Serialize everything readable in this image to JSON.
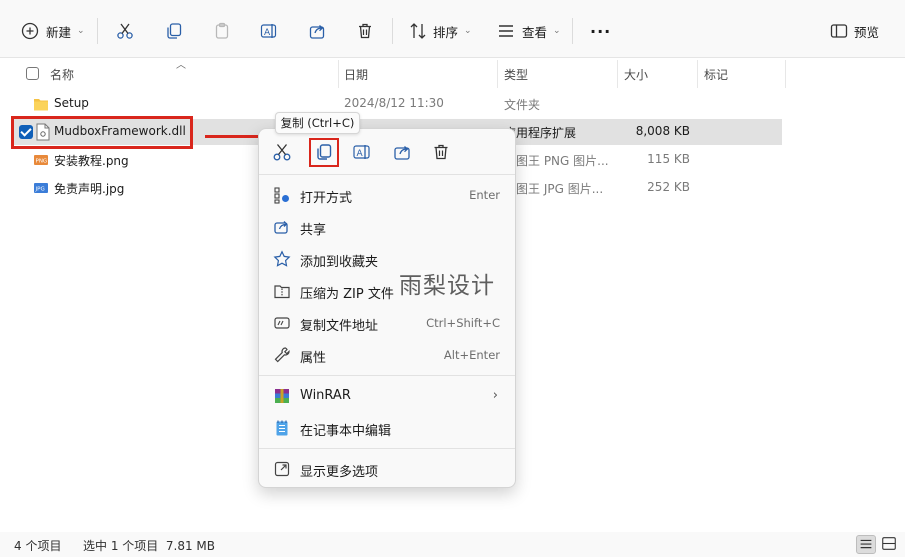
{
  "toolbar": {
    "new_label": "新建",
    "sort_label": "排序",
    "view_label": "查看",
    "more_label": "···",
    "preview_label": "预览"
  },
  "columns": {
    "name": "名称",
    "date": "日期",
    "type": "类型",
    "size": "大小",
    "tags": "标记"
  },
  "files": [
    {
      "name": "Setup",
      "date": "2024/8/12 11:30",
      "type": "文件夹",
      "size": "",
      "icon": "folder-icon"
    },
    {
      "name": "MudboxFramework.dll",
      "date": "",
      "type": "应用程序扩展",
      "size": "8,008 KB",
      "icon": "dll-file-icon",
      "selected": true
    },
    {
      "name": "安装教程.png",
      "date": "",
      "type": "看图王 PNG 图片...",
      "size": "115 KB",
      "icon": "png-file-icon"
    },
    {
      "name": "免责声明.jpg",
      "date": "",
      "type": "看图王 JPG 图片...",
      "size": "252 KB",
      "icon": "jpg-file-icon"
    }
  ],
  "tooltip": "复制 (Ctrl+C)",
  "context_menu": {
    "items": [
      {
        "label": "打开方式",
        "shortcut": "Enter"
      },
      {
        "label": "共享",
        "shortcut": ""
      },
      {
        "label": "添加到收藏夹",
        "shortcut": ""
      },
      {
        "label": "压缩为 ZIP 文件",
        "shortcut": ""
      },
      {
        "label": "复制文件地址",
        "shortcut": "Ctrl+Shift+C"
      },
      {
        "label": "属性",
        "shortcut": "Alt+Enter"
      },
      {
        "label": "WinRAR",
        "shortcut": ""
      },
      {
        "label": "在记事本中编辑",
        "shortcut": ""
      },
      {
        "label": "显示更多选项",
        "shortcut": ""
      }
    ]
  },
  "watermark": "雨梨设计",
  "status": {
    "count": "4 个项目",
    "selection": "选中 1 个项目  7.81 MB"
  },
  "colors": {
    "accent": "#0f5fb8",
    "highlight_red": "#d9261c",
    "selected_row": "#e1e1e1"
  }
}
